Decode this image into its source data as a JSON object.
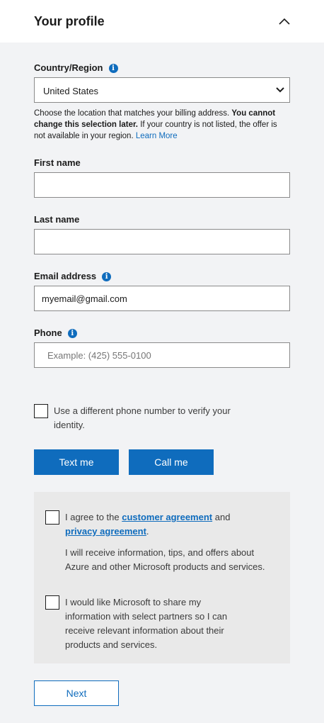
{
  "header": {
    "title": "Your profile",
    "toggle_icon": "chevron-up-icon"
  },
  "country": {
    "label": "Country/Region",
    "selected": "United States",
    "help_prefix": "Choose the location that matches your billing address. ",
    "help_bold": "You cannot change this selection later.",
    "help_suffix": " If your country is not listed, the offer is not available in your region. ",
    "learn_more": "Learn More"
  },
  "first_name": {
    "label": "First name",
    "value": "",
    "placeholder": ""
  },
  "last_name": {
    "label": "Last name",
    "value": "",
    "placeholder": ""
  },
  "email": {
    "label": "Email address",
    "value": "myemail@gmail.com"
  },
  "phone": {
    "label": "Phone",
    "placeholder": "Example: (425) 555-0100"
  },
  "verify": {
    "different_number_line1": "Use a different phone number to verify your",
    "different_number_line2": "identity.",
    "text_me": "Text me",
    "call_me": "Call me"
  },
  "consent": {
    "agree_prefix": "I agree to the ",
    "customer_agreement": "customer agreement",
    "agree_and": " and",
    "privacy_agreement": "privacy agreement",
    "agree_period": ".",
    "info_text": "I will receive information, tips, and offers about Azure and other Microsoft products and services.",
    "share_text": "I would like Microsoft to share my information with select partners so I can receive relevant information about their products and services."
  },
  "next_label": "Next",
  "colors": {
    "accent": "#0f6cbd",
    "background": "#f2f3f5",
    "consent_bg": "#e9e9e9"
  }
}
